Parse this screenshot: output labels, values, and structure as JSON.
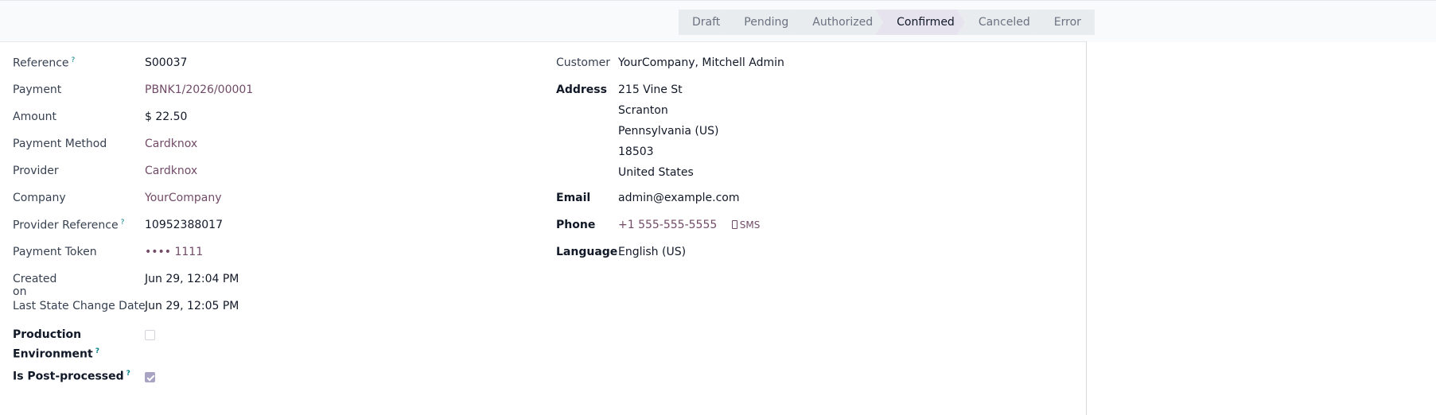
{
  "statusbar": {
    "stages": [
      {
        "label": "Draft"
      },
      {
        "label": "Pending"
      },
      {
        "label": "Authorized"
      },
      {
        "label": "Confirmed"
      },
      {
        "label": "Canceled"
      },
      {
        "label": "Error"
      }
    ],
    "active": "Confirmed"
  },
  "left": {
    "reference": {
      "label": "Reference",
      "value": "S00037",
      "help": "?"
    },
    "payment": {
      "label": "Payment",
      "value": "PBNK1/2026/00001"
    },
    "amount": {
      "label": "Amount",
      "value": "$ 22.50"
    },
    "payment_method": {
      "label": "Payment Method",
      "value": "Cardknox"
    },
    "provider": {
      "label": "Provider",
      "value": "Cardknox"
    },
    "company": {
      "label": "Company",
      "value": "YourCompany"
    },
    "provider_reference": {
      "label": "Provider Reference",
      "value": "10952388017",
      "help": "?"
    },
    "payment_token": {
      "label": "Payment Token",
      "value": "•••• 1111"
    },
    "created_on": {
      "label": "Created on",
      "value": "Jun 29, 12:04 PM"
    },
    "last_state_change": {
      "label": "Last State Change Date",
      "value": "Jun 29, 12:05 PM"
    },
    "production_env": {
      "label_line1": "Production",
      "label_line2": "Environment",
      "help": "?",
      "checked": false
    },
    "post_processed": {
      "label": "Is Post-processed",
      "help": "?",
      "checked": true
    }
  },
  "right": {
    "customer": {
      "label": "Customer",
      "value": "YourCompany, Mitchell Admin"
    },
    "address": {
      "label": "Address",
      "lines": [
        "215 Vine St",
        "Scranton",
        "Pennsylvania (US)",
        "18503",
        "United States"
      ]
    },
    "email": {
      "label": "Email",
      "value": "admin@example.com"
    },
    "phone": {
      "label": "Phone",
      "value": "+1 555-555-5555",
      "sms": "SMS"
    },
    "language": {
      "label": "Language",
      "value": "English (US)"
    }
  },
  "colors": {
    "link": "#714b67",
    "help": "#017e84",
    "active_stage": "#e6e2ee"
  }
}
